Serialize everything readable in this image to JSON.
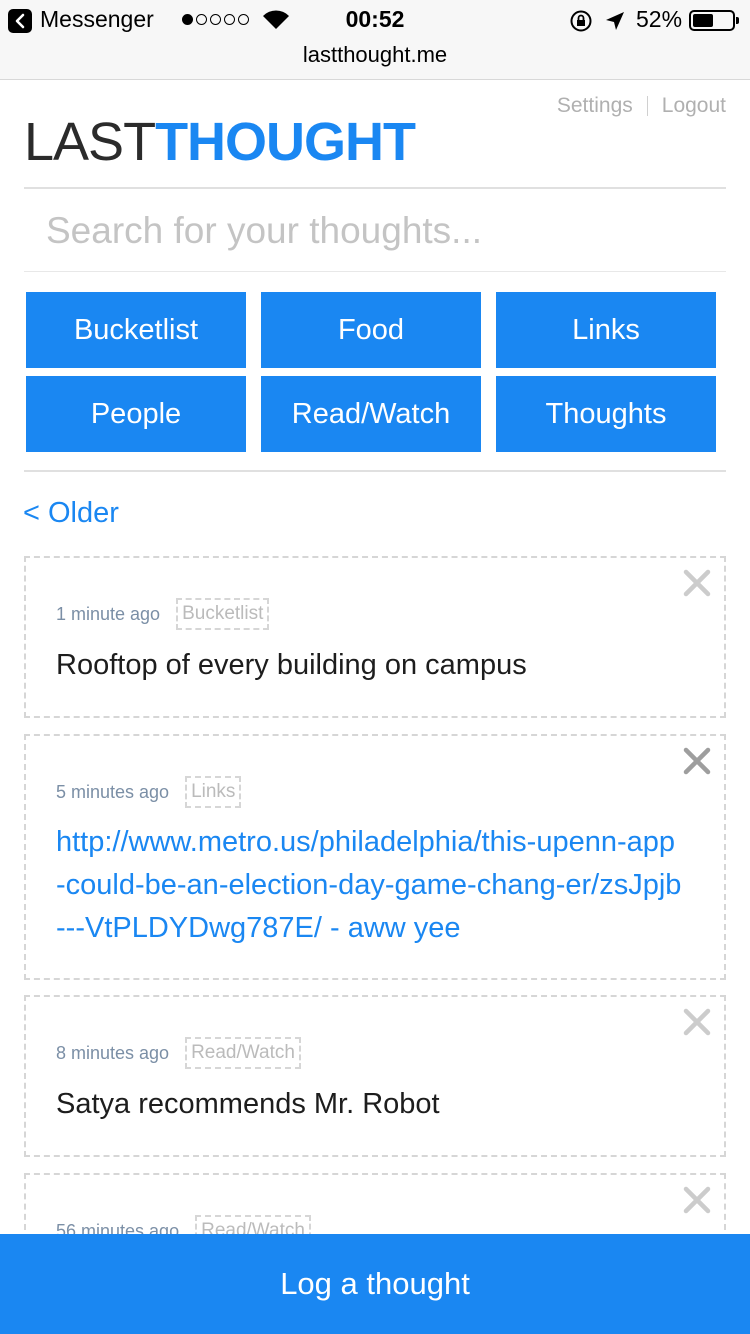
{
  "statusbar": {
    "back_app": "Messenger",
    "time": "00:52",
    "battery_pct": "52%",
    "battery_level": 0.52,
    "signal_bars_on": 1,
    "signal_bars_total": 5
  },
  "browser": {
    "url": "lastthought.me"
  },
  "nav": {
    "settings": "Settings",
    "logout": "Logout"
  },
  "logo": {
    "part1": "LAST",
    "part2": "THOUGHT"
  },
  "search": {
    "placeholder": "Search for your thoughts..."
  },
  "categories": [
    "Bucketlist",
    "Food",
    "Links",
    "People",
    "Read/Watch",
    "Thoughts"
  ],
  "pagination": {
    "older": "< Older"
  },
  "thoughts": [
    {
      "time": "1 minute ago",
      "tag": "Bucketlist",
      "text": "Rooftop of every building on campus",
      "is_link": false
    },
    {
      "time": "5 minutes ago",
      "tag": "Links",
      "text": "http://www.metro.us/philadelphia/this-upenn-app-could-be-an-election-day-game-chang-er/zsJpjb---VtPLDYDwg787E/ - aww yee",
      "is_link": true
    },
    {
      "time": "8 minutes ago",
      "tag": "Read/Watch",
      "text": "Satya recommends Mr. Robot",
      "is_link": false
    },
    {
      "time": "56 minutes ago",
      "tag": "Read/Watch",
      "text": "",
      "is_link": false
    }
  ],
  "footer": {
    "log_button": "Log a thought"
  },
  "colors": {
    "accent": "#1a87f2",
    "muted": "#b0b0b0",
    "dashed_border": "#d6d6d6"
  },
  "icons": [
    "back-icon",
    "wifi-icon",
    "rotation-lock-icon",
    "location-arrow-icon",
    "battery-icon",
    "close-icon"
  ]
}
